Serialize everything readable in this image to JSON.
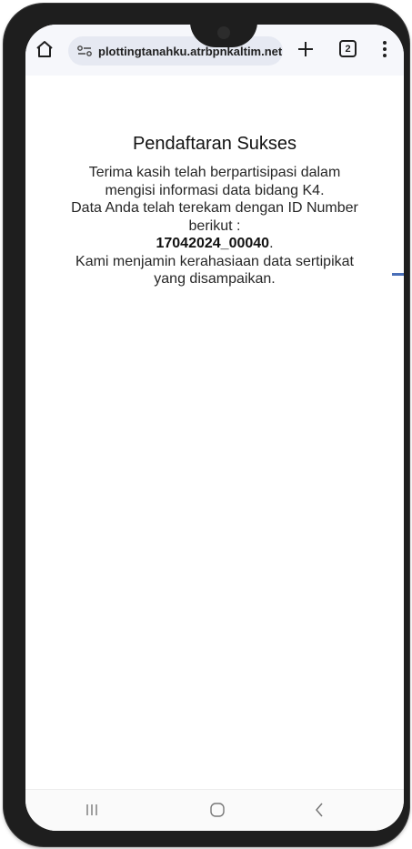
{
  "browser": {
    "url": "plottingtanahku.atrbpnkaltim.net",
    "tab_count": "2"
  },
  "page": {
    "title": "Pendaftaran Sukses",
    "lines": [
      "Terima kasih telah berpartisipasi dalam",
      "mengisi informasi data bidang K4.",
      "Data Anda telah terekam dengan ID Number",
      "berikut :"
    ],
    "id_number": "17042024_00040",
    "id_suffix": ".",
    "closing_lines": [
      "Kami menjamin kerahasiaan data sertipikat",
      "yang disampaikan."
    ]
  },
  "icons": {
    "home": "home-icon",
    "site_settings": "tune-icon",
    "new_tab": "plus-icon",
    "tabs": "tab-switcher-icon",
    "menu": "more-vert-icon",
    "nav_recent": "recent-apps-icon",
    "nav_home": "nav-home-icon",
    "nav_back": "back-icon"
  },
  "colors": {
    "toolbar_bg": "#f6f7fb",
    "url_pill_bg": "#e6e9f2",
    "accent_line": "#4a6fb8",
    "device_frame": "#1e1e1e"
  }
}
